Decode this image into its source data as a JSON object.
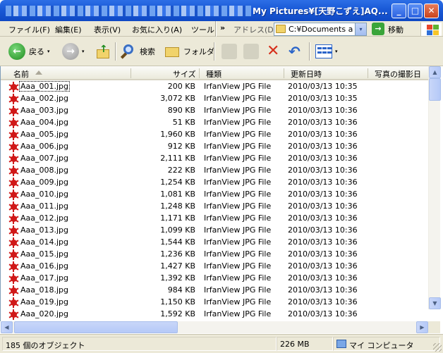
{
  "window": {
    "title": "My Pictures¥[天野こずえ]AQ...",
    "minimize_glyph": "_",
    "maximize_glyph": "□",
    "close_glyph": "✕"
  },
  "menu": {
    "items": [
      "ファイル(F)",
      "編集(E)",
      "表示(V)",
      "お気に入り(A)",
      "ツール"
    ],
    "overflow": "»",
    "address_label": "アドレス(D)",
    "address_value": "C:¥Documents and Settings",
    "go_label": "移動",
    "go_glyph": "→"
  },
  "toolbar": {
    "back_label": "戻る",
    "back_glyph": "←",
    "forward_glyph": "→",
    "up_glyph": "↑",
    "search_label": "検索",
    "folders_label": "フォルダ",
    "delete_glyph": "✕",
    "undo_glyph": "↶",
    "dropdown_glyph": "▾"
  },
  "columns": {
    "name": "名前",
    "size": "サイズ",
    "type": "種類",
    "modified": "更新日時",
    "taken": "写真の撮影日"
  },
  "files": [
    {
      "name": "Aaa_001.jpg",
      "size": "200 KB",
      "type": "IrfanView JPG File",
      "date": "2010/03/13 10:35"
    },
    {
      "name": "Aaa_002.jpg",
      "size": "3,072 KB",
      "type": "IrfanView JPG File",
      "date": "2010/03/13 10:35"
    },
    {
      "name": "Aaa_003.jpg",
      "size": "890 KB",
      "type": "IrfanView JPG File",
      "date": "2010/03/13 10:36"
    },
    {
      "name": "Aaa_004.jpg",
      "size": "51 KB",
      "type": "IrfanView JPG File",
      "date": "2010/03/13 10:36"
    },
    {
      "name": "Aaa_005.jpg",
      "size": "1,960 KB",
      "type": "IrfanView JPG File",
      "date": "2010/03/13 10:36"
    },
    {
      "name": "Aaa_006.jpg",
      "size": "912 KB",
      "type": "IrfanView JPG File",
      "date": "2010/03/13 10:36"
    },
    {
      "name": "Aaa_007.jpg",
      "size": "2,111 KB",
      "type": "IrfanView JPG File",
      "date": "2010/03/13 10:36"
    },
    {
      "name": "Aaa_008.jpg",
      "size": "222 KB",
      "type": "IrfanView JPG File",
      "date": "2010/03/13 10:36"
    },
    {
      "name": "Aaa_009.jpg",
      "size": "1,254 KB",
      "type": "IrfanView JPG File",
      "date": "2010/03/13 10:36"
    },
    {
      "name": "Aaa_010.jpg",
      "size": "1,081 KB",
      "type": "IrfanView JPG File",
      "date": "2010/03/13 10:36"
    },
    {
      "name": "Aaa_011.jpg",
      "size": "1,248 KB",
      "type": "IrfanView JPG File",
      "date": "2010/03/13 10:36"
    },
    {
      "name": "Aaa_012.jpg",
      "size": "1,171 KB",
      "type": "IrfanView JPG File",
      "date": "2010/03/13 10:36"
    },
    {
      "name": "Aaa_013.jpg",
      "size": "1,099 KB",
      "type": "IrfanView JPG File",
      "date": "2010/03/13 10:36"
    },
    {
      "name": "Aaa_014.jpg",
      "size": "1,544 KB",
      "type": "IrfanView JPG File",
      "date": "2010/03/13 10:36"
    },
    {
      "name": "Aaa_015.jpg",
      "size": "1,236 KB",
      "type": "IrfanView JPG File",
      "date": "2010/03/13 10:36"
    },
    {
      "name": "Aaa_016.jpg",
      "size": "1,427 KB",
      "type": "IrfanView JPG File",
      "date": "2010/03/13 10:36"
    },
    {
      "name": "Aaa_017.jpg",
      "size": "1,392 KB",
      "type": "IrfanView JPG File",
      "date": "2010/03/13 10:36"
    },
    {
      "name": "Aaa_018.jpg",
      "size": "984 KB",
      "type": "IrfanView JPG File",
      "date": "2010/03/13 10:36"
    },
    {
      "name": "Aaa_019.jpg",
      "size": "1,150 KB",
      "type": "IrfanView JPG File",
      "date": "2010/03/13 10:36"
    },
    {
      "name": "Aaa_020.jpg",
      "size": "1,592 KB",
      "type": "IrfanView JPG File",
      "date": "2010/03/13 10:36"
    }
  ],
  "scrollbar": {
    "up_glyph": "▲",
    "down_glyph": "▼",
    "left_glyph": "◀",
    "right_glyph": "▶"
  },
  "status": {
    "objects": "185 個のオブジェクト",
    "total_size": "226 MB",
    "location": "マイ コンピュータ"
  },
  "icons": {
    "file_icon": "irfanview-jpg-icon",
    "computer_icon": "my-computer-icon"
  }
}
